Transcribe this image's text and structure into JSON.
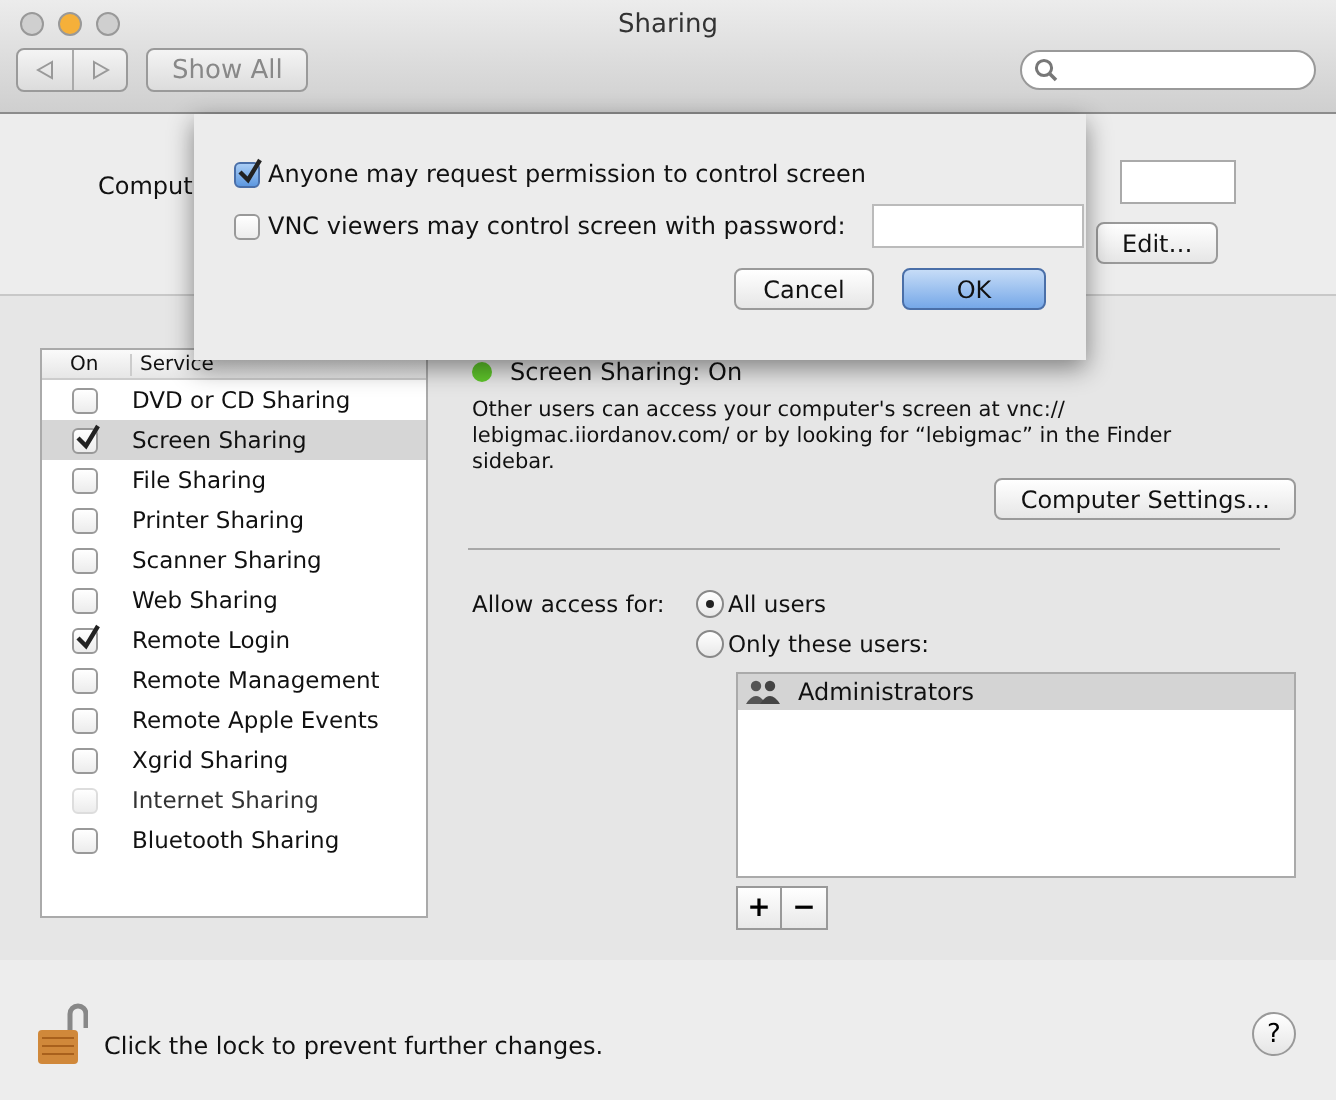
{
  "window": {
    "title": "Sharing"
  },
  "toolbar": {
    "show_all": "Show All"
  },
  "computer_name": {
    "label": "Comput",
    "edit_button": "Edit…"
  },
  "sheet": {
    "options": [
      {
        "kind": "checkbox",
        "label": "Anyone may request permission to control screen",
        "checked": true
      },
      {
        "kind": "checkbox-field",
        "label": "VNC viewers may control screen with password:",
        "checked": false
      }
    ],
    "buttons": [
      {
        "label": "Cancel",
        "default": false
      },
      {
        "label": "OK",
        "default": true
      }
    ]
  },
  "services": {
    "columns": [
      "On",
      "Service"
    ],
    "rows": [
      {
        "name": "DVD or CD Sharing",
        "on": false,
        "selected": false,
        "disabled": false
      },
      {
        "name": "Screen Sharing",
        "on": true,
        "selected": true,
        "disabled": false
      },
      {
        "name": "File Sharing",
        "on": false,
        "selected": false,
        "disabled": false
      },
      {
        "name": "Printer Sharing",
        "on": false,
        "selected": false,
        "disabled": false
      },
      {
        "name": "Scanner Sharing",
        "on": false,
        "selected": false,
        "disabled": false
      },
      {
        "name": "Web Sharing",
        "on": false,
        "selected": false,
        "disabled": false
      },
      {
        "name": "Remote Login",
        "on": true,
        "selected": false,
        "disabled": false
      },
      {
        "name": "Remote Management",
        "on": false,
        "selected": false,
        "disabled": false
      },
      {
        "name": "Remote Apple Events",
        "on": false,
        "selected": false,
        "disabled": false
      },
      {
        "name": "Xgrid Sharing",
        "on": false,
        "selected": false,
        "disabled": false
      },
      {
        "name": "Internet Sharing",
        "on": false,
        "selected": false,
        "disabled": true
      },
      {
        "name": "Bluetooth Sharing",
        "on": false,
        "selected": false,
        "disabled": false
      }
    ]
  },
  "status": {
    "text": "Screen Sharing: On",
    "on": true
  },
  "description": "Other users can access your computer's screen at vnc:// lebigmac.iiordanov.com/ or by looking for “lebigmac” in the Finder sidebar.",
  "computer_settings": "Computer Settings…",
  "access": {
    "label": "Allow access for:",
    "options": [
      {
        "label": "All users",
        "selected": true
      },
      {
        "label": "Only these users:",
        "selected": false
      }
    ],
    "users": [
      {
        "name": "Administrators",
        "selected": true
      }
    ],
    "add": "+",
    "remove": "−"
  },
  "footer": {
    "lock_text": "Click the lock to prevent further changes.",
    "help": "?"
  }
}
